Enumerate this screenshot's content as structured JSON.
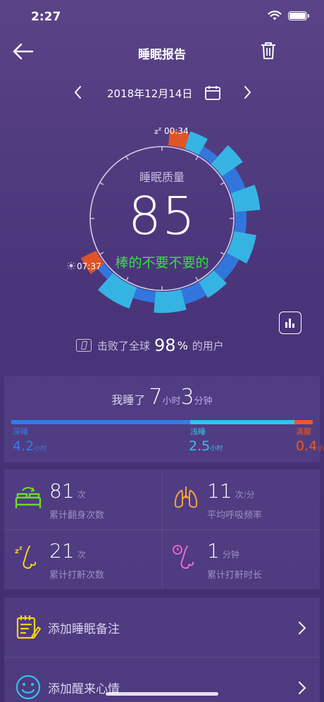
{
  "status_bar": {
    "time": "2:27"
  },
  "nav": {
    "title": "睡眠报告",
    "back_icon": "arrow-left-icon",
    "delete_icon": "trash-icon"
  },
  "date": {
    "text": "2018年12月14日"
  },
  "dial": {
    "label": "睡眠质量",
    "score": "85",
    "tag": "棒的不要不要的",
    "sleep_start": "00:34",
    "wake_time": "07:37",
    "tag_color": "#2fe53c"
  },
  "rank": {
    "prefix": "击败了全球",
    "percent": "98",
    "percent_sign": "%",
    "suffix": "的用户"
  },
  "duration": {
    "prefix": "我睡了",
    "hours": "7",
    "hours_unit": "小时",
    "minutes": "3",
    "minutes_unit": "分钟",
    "phases": [
      {
        "label": "深睡",
        "value": "4.2",
        "unit": "小时",
        "color": "#2f7de8"
      },
      {
        "label": "浅睡",
        "value": "2.5",
        "unit": "小时",
        "color": "#33c2ee"
      },
      {
        "label": "清醒",
        "value": "0.4",
        "unit": "小时",
        "color": "#f0581e"
      }
    ]
  },
  "stats": [
    {
      "value": "81",
      "unit": "次",
      "label": "累计翻身次数",
      "icon": "bed-icon",
      "color": "#6ddb2c"
    },
    {
      "value": "11",
      "unit": "次/分",
      "label": "平均呼吸频率",
      "icon": "lungs-icon",
      "color": "#f5a23c"
    },
    {
      "value": "21",
      "unit": "次",
      "label": "累计打鼾次数",
      "icon": "snore-icon",
      "color": "#f5d31c"
    },
    {
      "value": "1",
      "unit": "分钟",
      "label": "累计打鼾时长",
      "icon": "snore-duration-icon",
      "color": "#f06ad0"
    }
  ],
  "menu": [
    {
      "label": "添加睡眠备注",
      "icon": "note-icon"
    },
    {
      "label": "添加醒来心情",
      "icon": "smiley-icon"
    }
  ]
}
